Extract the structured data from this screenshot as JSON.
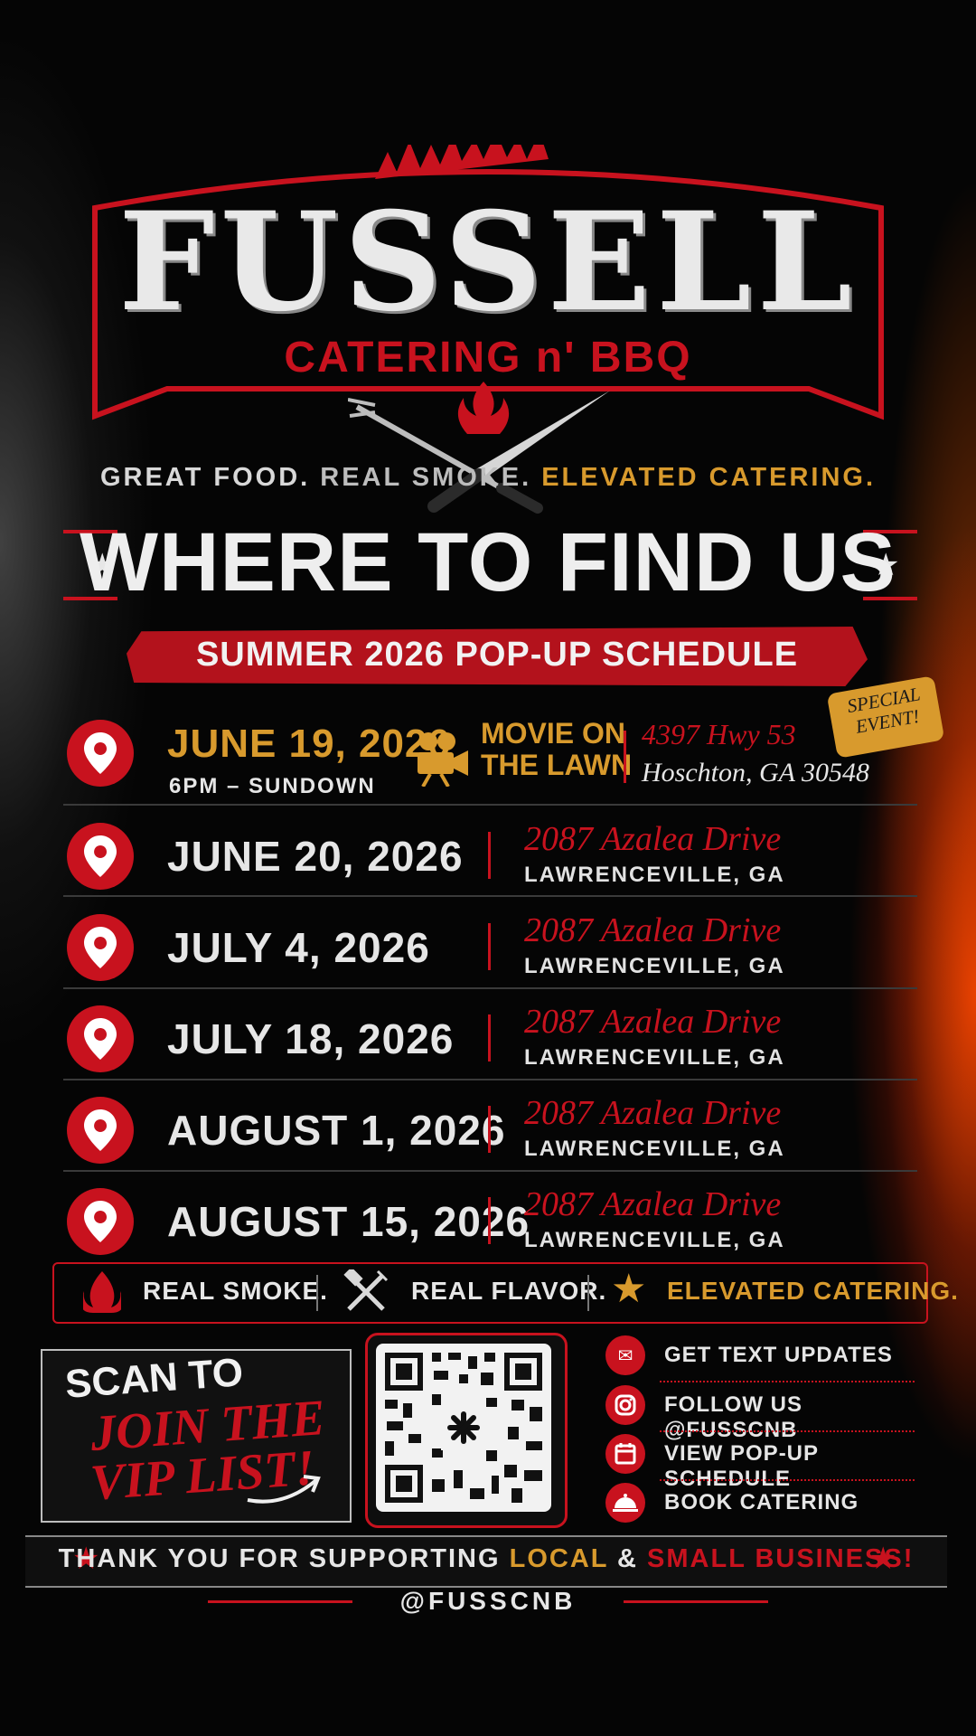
{
  "brand": {
    "name": "FUSSELL",
    "subtitle": "CATERING n' BBQ"
  },
  "tagline": {
    "part1": "GREAT FOOD.",
    "part2": "REAL SMOKE.",
    "part3": "ELEVATED CATERING."
  },
  "heading": "WHERE TO FIND US",
  "schedule_label": "SUMMER 2026 POP-UP SCHEDULE",
  "special_event": {
    "badge": "SPECIAL EVENT!",
    "date": "JUNE 19, 2026",
    "time": "6PM – SUNDOWN",
    "event_line1": "MOVIE ON",
    "event_line2": "THE LAWN",
    "street": "4397 Hwy 53",
    "city": "Hoschton, GA 30548"
  },
  "stops": [
    {
      "date": "JUNE 20, 2026",
      "street": "2087 Azalea Drive",
      "city": "LAWRENCEVILLE, GA"
    },
    {
      "date": "JULY 4, 2026",
      "street": "2087 Azalea Drive",
      "city": "LAWRENCEVILLE, GA"
    },
    {
      "date": "JULY 18, 2026",
      "street": "2087 Azalea Drive",
      "city": "LAWRENCEVILLE, GA"
    },
    {
      "date": "AUGUST 1, 2026",
      "street": "2087 Azalea Drive",
      "city": "LAWRENCEVILLE, GA"
    },
    {
      "date": "AUGUST 15, 2026",
      "street": "2087 Azalea Drive",
      "city": "LAWRENCEVILLE, GA"
    }
  ],
  "values": [
    "REAL SMOKE.",
    "REAL FLAVOR.",
    "ELEVATED CATERING."
  ],
  "vip": {
    "line1": "SCAN TO",
    "line2": "JOIN THE",
    "line3": "VIP LIST!"
  },
  "links": [
    {
      "label": "GET TEXT UPDATES",
      "icon": "phone-message-icon"
    },
    {
      "label": "FOLLOW US @FUSSCNB",
      "icon": "instagram-icon"
    },
    {
      "label": "VIEW POP-UP SCHEDULE",
      "icon": "calendar-icon"
    },
    {
      "label": "BOOK CATERING",
      "icon": "cloche-icon"
    }
  ],
  "footer": {
    "part1": "THANK YOU FOR SUPPORTING",
    "part2": "LOCAL",
    "part3": "&",
    "part4": "SMALL BUSINESS!",
    "handle": "@FUSSCNB"
  },
  "colors": {
    "accent_red": "#c8121e",
    "accent_gold": "#d89a2d",
    "background": "#050505"
  }
}
